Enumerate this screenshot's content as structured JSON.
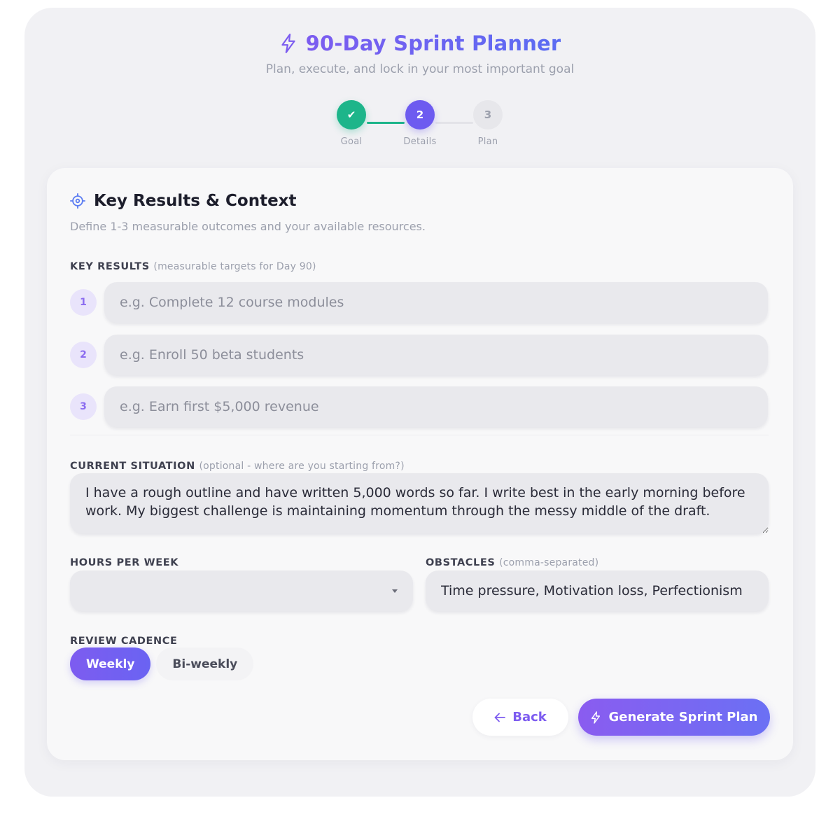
{
  "header": {
    "title": "90-Day Sprint Planner",
    "subtitle": "Plan, execute, and lock in your most important goal",
    "icon": "bolt-icon"
  },
  "stepper": {
    "steps": [
      {
        "label": "Goal",
        "marker": "✔",
        "state": "complete"
      },
      {
        "label": "Details",
        "marker": "2",
        "state": "active"
      },
      {
        "label": "Plan",
        "marker": "3",
        "state": "upcoming"
      }
    ]
  },
  "card": {
    "icon": "target-icon",
    "title": "Key Results & Context",
    "description": "Define 1-3 measurable outcomes and your available resources."
  },
  "key_results": {
    "label": "KEY RESULTS",
    "hint": "(measurable targets for Day 90)",
    "items": [
      {
        "number": "1",
        "value": "",
        "placeholder": "e.g. Complete 12 course modules"
      },
      {
        "number": "2",
        "value": "",
        "placeholder": "e.g. Enroll 50 beta students"
      },
      {
        "number": "3",
        "value": "",
        "placeholder": "e.g. Earn first $5,000 revenue"
      }
    ]
  },
  "situation": {
    "label": "CURRENT SITUATION",
    "hint": "(optional - where are you starting from?)",
    "value": "I have a rough outline and have written 5,000 words so far. I write best in the early morning before work. My biggest challenge is maintaining momentum through the messy middle of the draft."
  },
  "hours": {
    "label": "HOURS PER WEEK",
    "selected": ""
  },
  "obstacles": {
    "label": "OBSTACLES",
    "hint": "(comma-separated)",
    "value": "Time pressure, Motivation loss, Perfectionism"
  },
  "cadence": {
    "label": "REVIEW CADENCE",
    "options": [
      "Weekly",
      "Bi-weekly"
    ],
    "selected": "Weekly"
  },
  "actions": {
    "back_label": "Back",
    "generate_label": "Generate Sprint Plan"
  },
  "colors": {
    "accent": "#6d5bf0",
    "success": "#1db58a",
    "background": "#f1f1f4"
  }
}
